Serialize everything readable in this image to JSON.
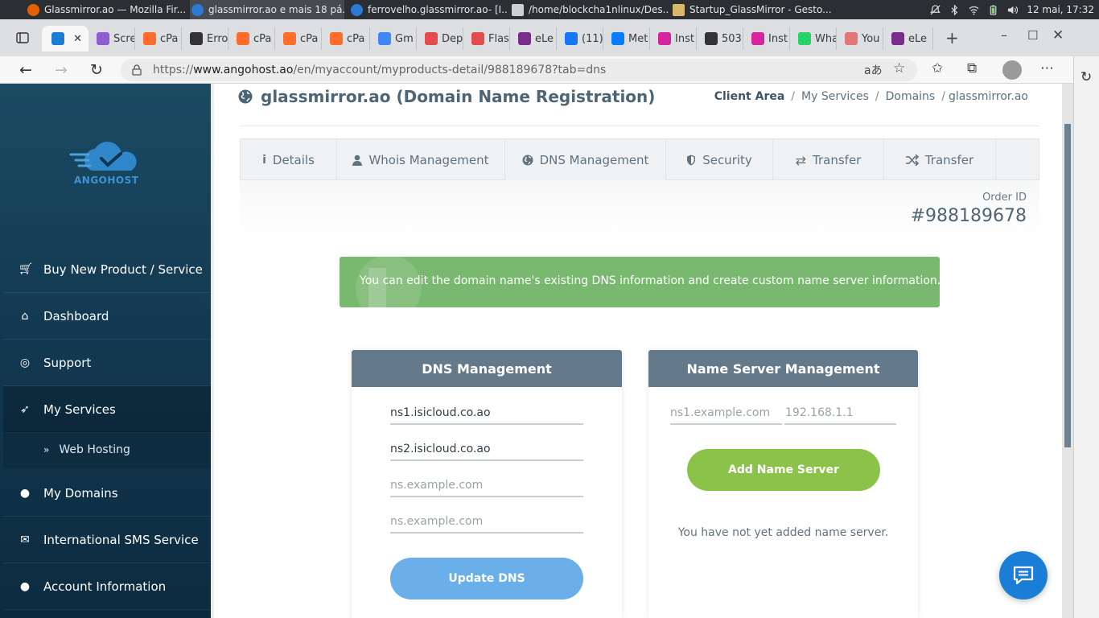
{
  "os_taskbar": {
    "tasks": [
      {
        "title": "Glassmirror.ao — Mozilla Fir...",
        "color": "#e66000"
      },
      {
        "title": "glassmirror.ao e mais 18 pá...",
        "color": "#2b7bd6"
      },
      {
        "title": "ferrovelho.glassmirror.ao- [I...",
        "color": "#2b7bd6"
      },
      {
        "title": "/home/blockcha1nlinux/Des...",
        "color": "#cfcfcf"
      },
      {
        "title": "Startup_GlassMirror - Gesto...",
        "color": "#d9b86b"
      }
    ],
    "clock": "12 mai, 17:32"
  },
  "browser": {
    "tabs": [
      {
        "label": "",
        "icon_color": "#1b7ed6",
        "icon": "cloud-icon",
        "active": true
      },
      {
        "label": "Scre",
        "icon_color": "#8e5fd1",
        "icon": "pen-icon"
      },
      {
        "label": "cPa",
        "icon_color": "#ff6c2c",
        "icon": "cpanel-icon"
      },
      {
        "label": "Erro",
        "icon_color": "#333333",
        "icon": "page-icon"
      },
      {
        "label": "cPa",
        "icon_color": "#ff6c2c",
        "icon": "cpanel-icon"
      },
      {
        "label": "cPa",
        "icon_color": "#ff6c2c",
        "icon": "cpanel-icon"
      },
      {
        "label": "cPa",
        "icon_color": "#ff6c2c",
        "icon": "cpanel-icon"
      },
      {
        "label": "Gm",
        "icon_color": "#4285f4",
        "icon": "google-icon"
      },
      {
        "label": "Dep",
        "icon_color": "#e24c4c",
        "icon": "youtube-icon"
      },
      {
        "label": "Flas",
        "icon_color": "#e24c4c",
        "icon": "youtube-icon"
      },
      {
        "label": "eLe",
        "icon_color": "#7a2c8c",
        "icon": "e-icon"
      },
      {
        "label": "(11)",
        "icon_color": "#1877f2",
        "icon": "facebook-icon"
      },
      {
        "label": "Met",
        "icon_color": "#0a7cff",
        "icon": "meta-icon"
      },
      {
        "label": "Inst",
        "icon_color": "#d6249f",
        "icon": "instagram-icon"
      },
      {
        "label": "503",
        "icon_color": "#333333",
        "icon": "page-icon"
      },
      {
        "label": "Inst",
        "icon_color": "#d6249f",
        "icon": "instagram-icon"
      },
      {
        "label": "Wha",
        "icon_color": "#25d366",
        "icon": "whatsapp-icon"
      },
      {
        "label": "You",
        "icon_color": "#e0787a",
        "icon": "download-icon"
      },
      {
        "label": "eLe",
        "icon_color": "#7a2c8c",
        "icon": "e-icon"
      }
    ],
    "url_prefix": "https://",
    "url_host": "www.angohost.ao",
    "url_path": "/en/myaccount/myproducts-detail/988189678?tab=dns"
  },
  "sidebar": {
    "brand": "ANGOHOST",
    "items": [
      {
        "label": "Buy New Product / Service",
        "icon": "cart-icon"
      },
      {
        "label": "Dashboard",
        "icon": "home-icon"
      },
      {
        "label": "Support",
        "icon": "lifebuoy-icon"
      },
      {
        "label": "My Services",
        "icon": "rocket-icon",
        "active": true
      },
      {
        "label": "My Domains",
        "icon": "globe-icon"
      },
      {
        "label": "International SMS Service",
        "icon": "mail-icon"
      },
      {
        "label": "Account Information",
        "icon": "user-icon"
      }
    ],
    "submenu": {
      "label": "Web Hosting",
      "icon": "double-chevron-icon"
    }
  },
  "page": {
    "title": "glassmirror.ao (Domain Name Registration)",
    "breadcrumb": [
      "Client Area",
      "My Services",
      "Domains",
      "glassmirror.ao"
    ],
    "tabs": [
      {
        "label": "Details",
        "icon": "info-icon"
      },
      {
        "label": "Whois Management",
        "icon": "user-icon"
      },
      {
        "label": "DNS Management",
        "icon": "globe-icon"
      },
      {
        "label": "Security",
        "icon": "shield-icon"
      },
      {
        "label": "Transfer",
        "icon": "exchange-icon"
      },
      {
        "label": "Transfer",
        "icon": "shuffle-icon"
      }
    ],
    "order_id_label": "Order ID",
    "order_id": "#988189678",
    "alert": "You can edit the domain name's existing DNS information and create custom name server information.",
    "dns": {
      "title": "DNS Management",
      "fields": [
        {
          "value": "ns1.isicloud.co.ao",
          "placeholder": ""
        },
        {
          "value": "ns2.isicloud.co.ao",
          "placeholder": ""
        },
        {
          "value": "",
          "placeholder": "ns.example.com"
        },
        {
          "value": "",
          "placeholder": "ns.example.com"
        }
      ],
      "button": "Update DNS"
    },
    "nameserver": {
      "title": "Name Server Management",
      "host_placeholder": "ns1.example.com",
      "ip_placeholder": "192.168.1.1",
      "button": "Add Name Server",
      "empty_message": "You have not yet added name server."
    }
  },
  "colors": {
    "sidebar": "#123850",
    "alert": "#79b86f",
    "box_header": "#64798a",
    "update_button": "#6aaeea",
    "add_button": "#8bc34a",
    "chat": "#1b7ed6"
  }
}
